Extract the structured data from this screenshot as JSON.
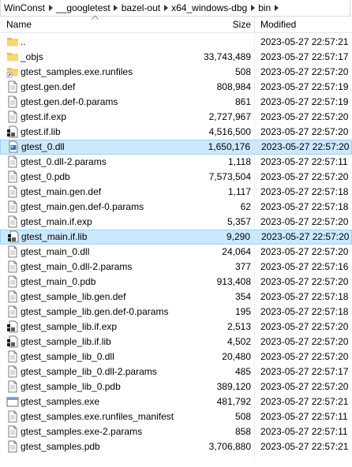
{
  "breadcrumb": [
    "WinConst",
    "__googletest",
    "bazel-out",
    "x64_windows-dbg",
    "bin"
  ],
  "columns": {
    "name": "Name",
    "size": "Size",
    "modified": "Modified"
  },
  "files": [
    {
      "name": "..",
      "size": "",
      "modified": "2023-05-27  22:57:21",
      "icon": "folder-icon"
    },
    {
      "name": "_objs",
      "size": "33,743,489",
      "modified": "2023-05-27  22:57:17",
      "icon": "folder-icon"
    },
    {
      "name": "gtest_samples.exe.runfiles",
      "size": "508",
      "modified": "2023-05-27  22:57:20",
      "icon": "folder-shortcut-icon"
    },
    {
      "name": "gtest.gen.def",
      "size": "808,984",
      "modified": "2023-05-27  22:57:19",
      "icon": "text-file-icon"
    },
    {
      "name": "gtest.gen.def-0.params",
      "size": "861",
      "modified": "2023-05-27  22:57:19",
      "icon": "text-file-icon"
    },
    {
      "name": "gtest.if.exp",
      "size": "2,727,967",
      "modified": "2023-05-27  22:57:20",
      "icon": "text-file-icon"
    },
    {
      "name": "gtest.if.lib",
      "size": "4,516,500",
      "modified": "2023-05-27  22:57:20",
      "icon": "library-file-icon"
    },
    {
      "name": "gtest_0.dll",
      "size": "1,650,176",
      "modified": "2023-05-27  22:57:20",
      "icon": "dll-file-icon",
      "selected": true
    },
    {
      "name": "gtest_0.dll-2.params",
      "size": "1,118",
      "modified": "2023-05-27  22:57:11",
      "icon": "text-file-icon"
    },
    {
      "name": "gtest_0.pdb",
      "size": "7,573,504",
      "modified": "2023-05-27  22:57:20",
      "icon": "text-file-icon"
    },
    {
      "name": "gtest_main.gen.def",
      "size": "1,117",
      "modified": "2023-05-27  22:57:18",
      "icon": "text-file-icon"
    },
    {
      "name": "gtest_main.gen.def-0.params",
      "size": "62",
      "modified": "2023-05-27  22:57:18",
      "icon": "text-file-icon"
    },
    {
      "name": "gtest_main.if.exp",
      "size": "5,357",
      "modified": "2023-05-27  22:57:20",
      "icon": "text-file-icon"
    },
    {
      "name": "gtest_main.if.lib",
      "size": "9,290",
      "modified": "2023-05-27  22:57:20",
      "icon": "library-file-icon",
      "selected": true
    },
    {
      "name": "gtest_main_0.dll",
      "size": "24,064",
      "modified": "2023-05-27  22:57:20",
      "icon": "text-file-icon"
    },
    {
      "name": "gtest_main_0.dll-2.params",
      "size": "377",
      "modified": "2023-05-27  22:57:16",
      "icon": "text-file-icon"
    },
    {
      "name": "gtest_main_0.pdb",
      "size": "913,408",
      "modified": "2023-05-27  22:57:20",
      "icon": "text-file-icon"
    },
    {
      "name": "gtest_sample_lib.gen.def",
      "size": "354",
      "modified": "2023-05-27  22:57:18",
      "icon": "text-file-icon"
    },
    {
      "name": "gtest_sample_lib.gen.def-0.params",
      "size": "195",
      "modified": "2023-05-27  22:57:18",
      "icon": "text-file-icon"
    },
    {
      "name": "gtest_sample_lib.if.exp",
      "size": "2,513",
      "modified": "2023-05-27  22:57:20",
      "icon": "library-file-icon"
    },
    {
      "name": "gtest_sample_lib.if.lib",
      "size": "4,502",
      "modified": "2023-05-27  22:57:20",
      "icon": "library-file-icon"
    },
    {
      "name": "gtest_sample_lib_0.dll",
      "size": "20,480",
      "modified": "2023-05-27  22:57:20",
      "icon": "text-file-icon"
    },
    {
      "name": "gtest_sample_lib_0.dll-2.params",
      "size": "485",
      "modified": "2023-05-27  22:57:17",
      "icon": "text-file-icon"
    },
    {
      "name": "gtest_sample_lib_0.pdb",
      "size": "389,120",
      "modified": "2023-05-27  22:57:20",
      "icon": "text-file-icon"
    },
    {
      "name": "gtest_samples.exe",
      "size": "481,792",
      "modified": "2023-05-27  22:57:21",
      "icon": "exe-file-icon"
    },
    {
      "name": "gtest_samples.exe.runfiles_manifest",
      "size": "508",
      "modified": "2023-05-27  22:57:11",
      "icon": "text-file-icon"
    },
    {
      "name": "gtest_samples.exe-2.params",
      "size": "858",
      "modified": "2023-05-27  22:57:11",
      "icon": "text-file-icon"
    },
    {
      "name": "gtest_samples.pdb",
      "size": "3,706,880",
      "modified": "2023-05-27  22:57:21",
      "icon": "text-file-icon"
    }
  ],
  "colors": {
    "selection_bg": "#cce8ff",
    "selection_border": "#99d1ff",
    "folder": "#f8d775"
  }
}
